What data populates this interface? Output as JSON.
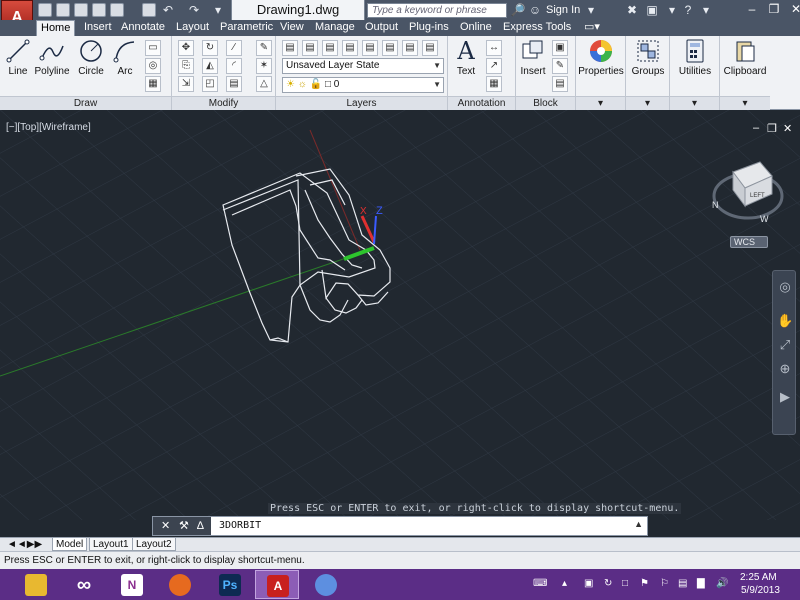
{
  "app": {
    "document_title": "Drawing1.dwg",
    "search_placeholder": "Type a keyword or phrase",
    "sign_in": "Sign In",
    "app_button_label": "A"
  },
  "ribbon_tabs": [
    "Home",
    "Insert",
    "Annotate",
    "Layout",
    "Parametric",
    "View",
    "Manage",
    "Output",
    "Plug-ins",
    "Online",
    "Express Tools"
  ],
  "ribbon": {
    "draw": {
      "title": "Draw",
      "line": "Line",
      "polyline": "Polyline",
      "circle": "Circle",
      "arc": "Arc"
    },
    "modify": {
      "title": "Modify"
    },
    "layers": {
      "title": "Layers",
      "layer_state": "Unsaved Layer State",
      "current_layer": "0"
    },
    "annotation": {
      "title": "Annotation",
      "text": "Text"
    },
    "block": {
      "title": "Block",
      "insert": "Insert"
    },
    "properties": "Properties",
    "groups": "Groups",
    "utilities": "Utilities",
    "clipboard": "Clipboard"
  },
  "viewport": {
    "label": "[−][Top][Wireframe]",
    "viewcube_face": "LEFT",
    "compass_n": "N",
    "compass_w": "W",
    "wcs": "WCS",
    "prompt_hint": "Press ESC or ENTER to exit, or right-click to display shortcut-menu."
  },
  "command_line": {
    "command": "3DORBIT"
  },
  "layout_tabs": [
    "Model",
    "Layout1",
    "Layout2"
  ],
  "status_bar": {
    "text": "Press ESC or ENTER to exit, or right-click to display shortcut-menu."
  },
  "taskbar": {
    "time": "2:25 AM",
    "date": "5/9/2013",
    "apps": [
      "file-explorer",
      "visual-studio",
      "onenote",
      "firefox",
      "photoshop",
      "autocad",
      "chat"
    ],
    "photoshop_label": "Ps",
    "onenote_label": "N"
  },
  "colors": {
    "viewport_bg": "#212830",
    "taskbar_bg": "#5b2d86",
    "axis_green": "#2dc42d",
    "axis_red": "#e03030",
    "axis_blue": "#3a5bff"
  }
}
